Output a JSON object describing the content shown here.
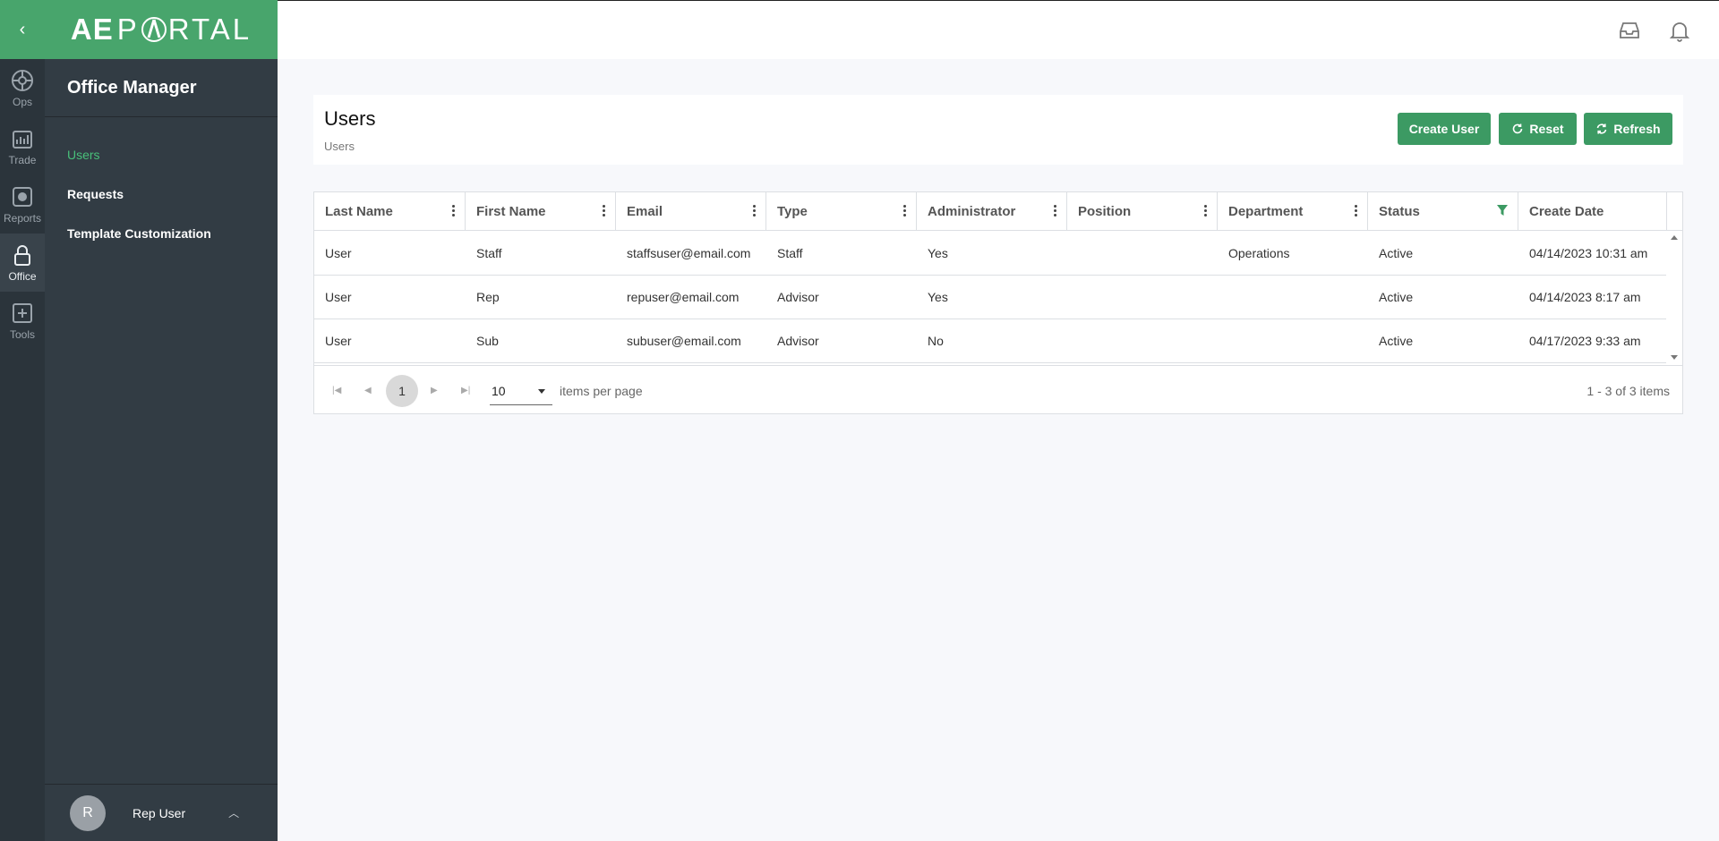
{
  "rail": {
    "collapse_glyph": "‹",
    "items": [
      {
        "label": "Ops",
        "icon": "ops-icon"
      },
      {
        "label": "Trade",
        "icon": "trade-icon"
      },
      {
        "label": "Reports",
        "icon": "reports-icon"
      },
      {
        "label": "Office",
        "icon": "lock-icon",
        "active": true
      },
      {
        "label": "Tools",
        "icon": "tools-icon"
      }
    ]
  },
  "brand": {
    "logo_prefix": "AE",
    "logo_p": "P",
    "logo_suffix": "RTAL"
  },
  "nav": {
    "heading": "Office Manager",
    "items": [
      {
        "label": "Users",
        "active": true
      },
      {
        "label": "Requests"
      },
      {
        "label": "Template Customization"
      }
    ]
  },
  "user": {
    "initial": "R",
    "name": "Rep User"
  },
  "topbar": {
    "icons": [
      "inbox-icon",
      "bell-icon"
    ]
  },
  "page": {
    "title": "Users",
    "breadcrumb": "Users",
    "buttons": {
      "create": "Create User",
      "reset": "Reset",
      "refresh": "Refresh"
    }
  },
  "table": {
    "columns": [
      "Last Name",
      "First Name",
      "Email",
      "Type",
      "Administrator",
      "Position",
      "Department",
      "Status",
      "Create Date"
    ],
    "rows": [
      [
        "User",
        "Staff",
        "staffsuser@email.com",
        "Staff",
        "Yes",
        "",
        "Operations",
        "Active",
        "04/14/2023 10:31 am"
      ],
      [
        "User",
        "Rep",
        "repuser@email.com",
        "Advisor",
        "Yes",
        "",
        "",
        "Active",
        "04/14/2023 8:17 am"
      ],
      [
        "User",
        "Sub",
        "subuser@email.com",
        "Advisor",
        "No",
        "",
        "",
        "Active",
        "04/17/2023 9:33 am"
      ]
    ]
  },
  "pager": {
    "current_page": "1",
    "page_size": "10",
    "page_size_label": "items per page",
    "info": "1 - 3 of 3 items"
  },
  "colors": {
    "brand_green": "#48a56c",
    "button_green": "#3c9a63",
    "active_nav": "#48c07a",
    "rail_bg": "#2b343b",
    "nav_bg": "#323c44"
  }
}
